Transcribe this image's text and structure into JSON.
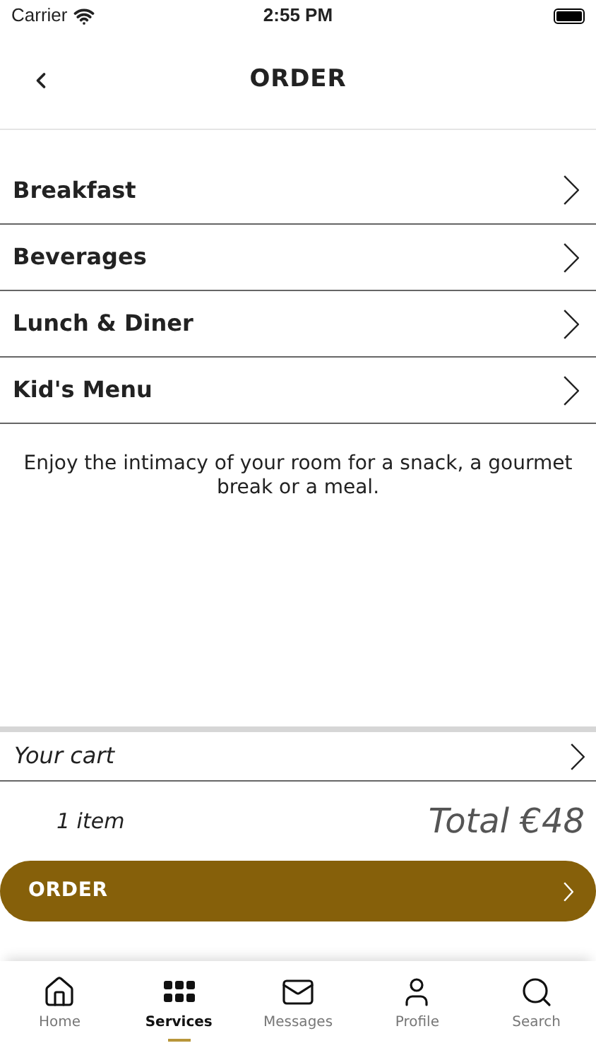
{
  "status_bar": {
    "carrier": "Carrier",
    "time": "2:55 PM"
  },
  "header": {
    "title": "ORDER"
  },
  "categories": [
    {
      "label": "Breakfast"
    },
    {
      "label": "Beverages"
    },
    {
      "label": "Lunch & Diner"
    },
    {
      "label": "Kid's Menu"
    }
  ],
  "description": "Enjoy the intimacy of your room for a snack, a gourmet break or a meal.",
  "cart": {
    "label": "Your cart",
    "count": "1 item",
    "total": "Total €48"
  },
  "order_button": "ORDER",
  "tab_bar": [
    {
      "label": "Home",
      "selected": false
    },
    {
      "label": "Services",
      "selected": true
    },
    {
      "label": "Messages",
      "selected": false
    },
    {
      "label": "Profile",
      "selected": false
    },
    {
      "label": "Search",
      "selected": false
    }
  ]
}
